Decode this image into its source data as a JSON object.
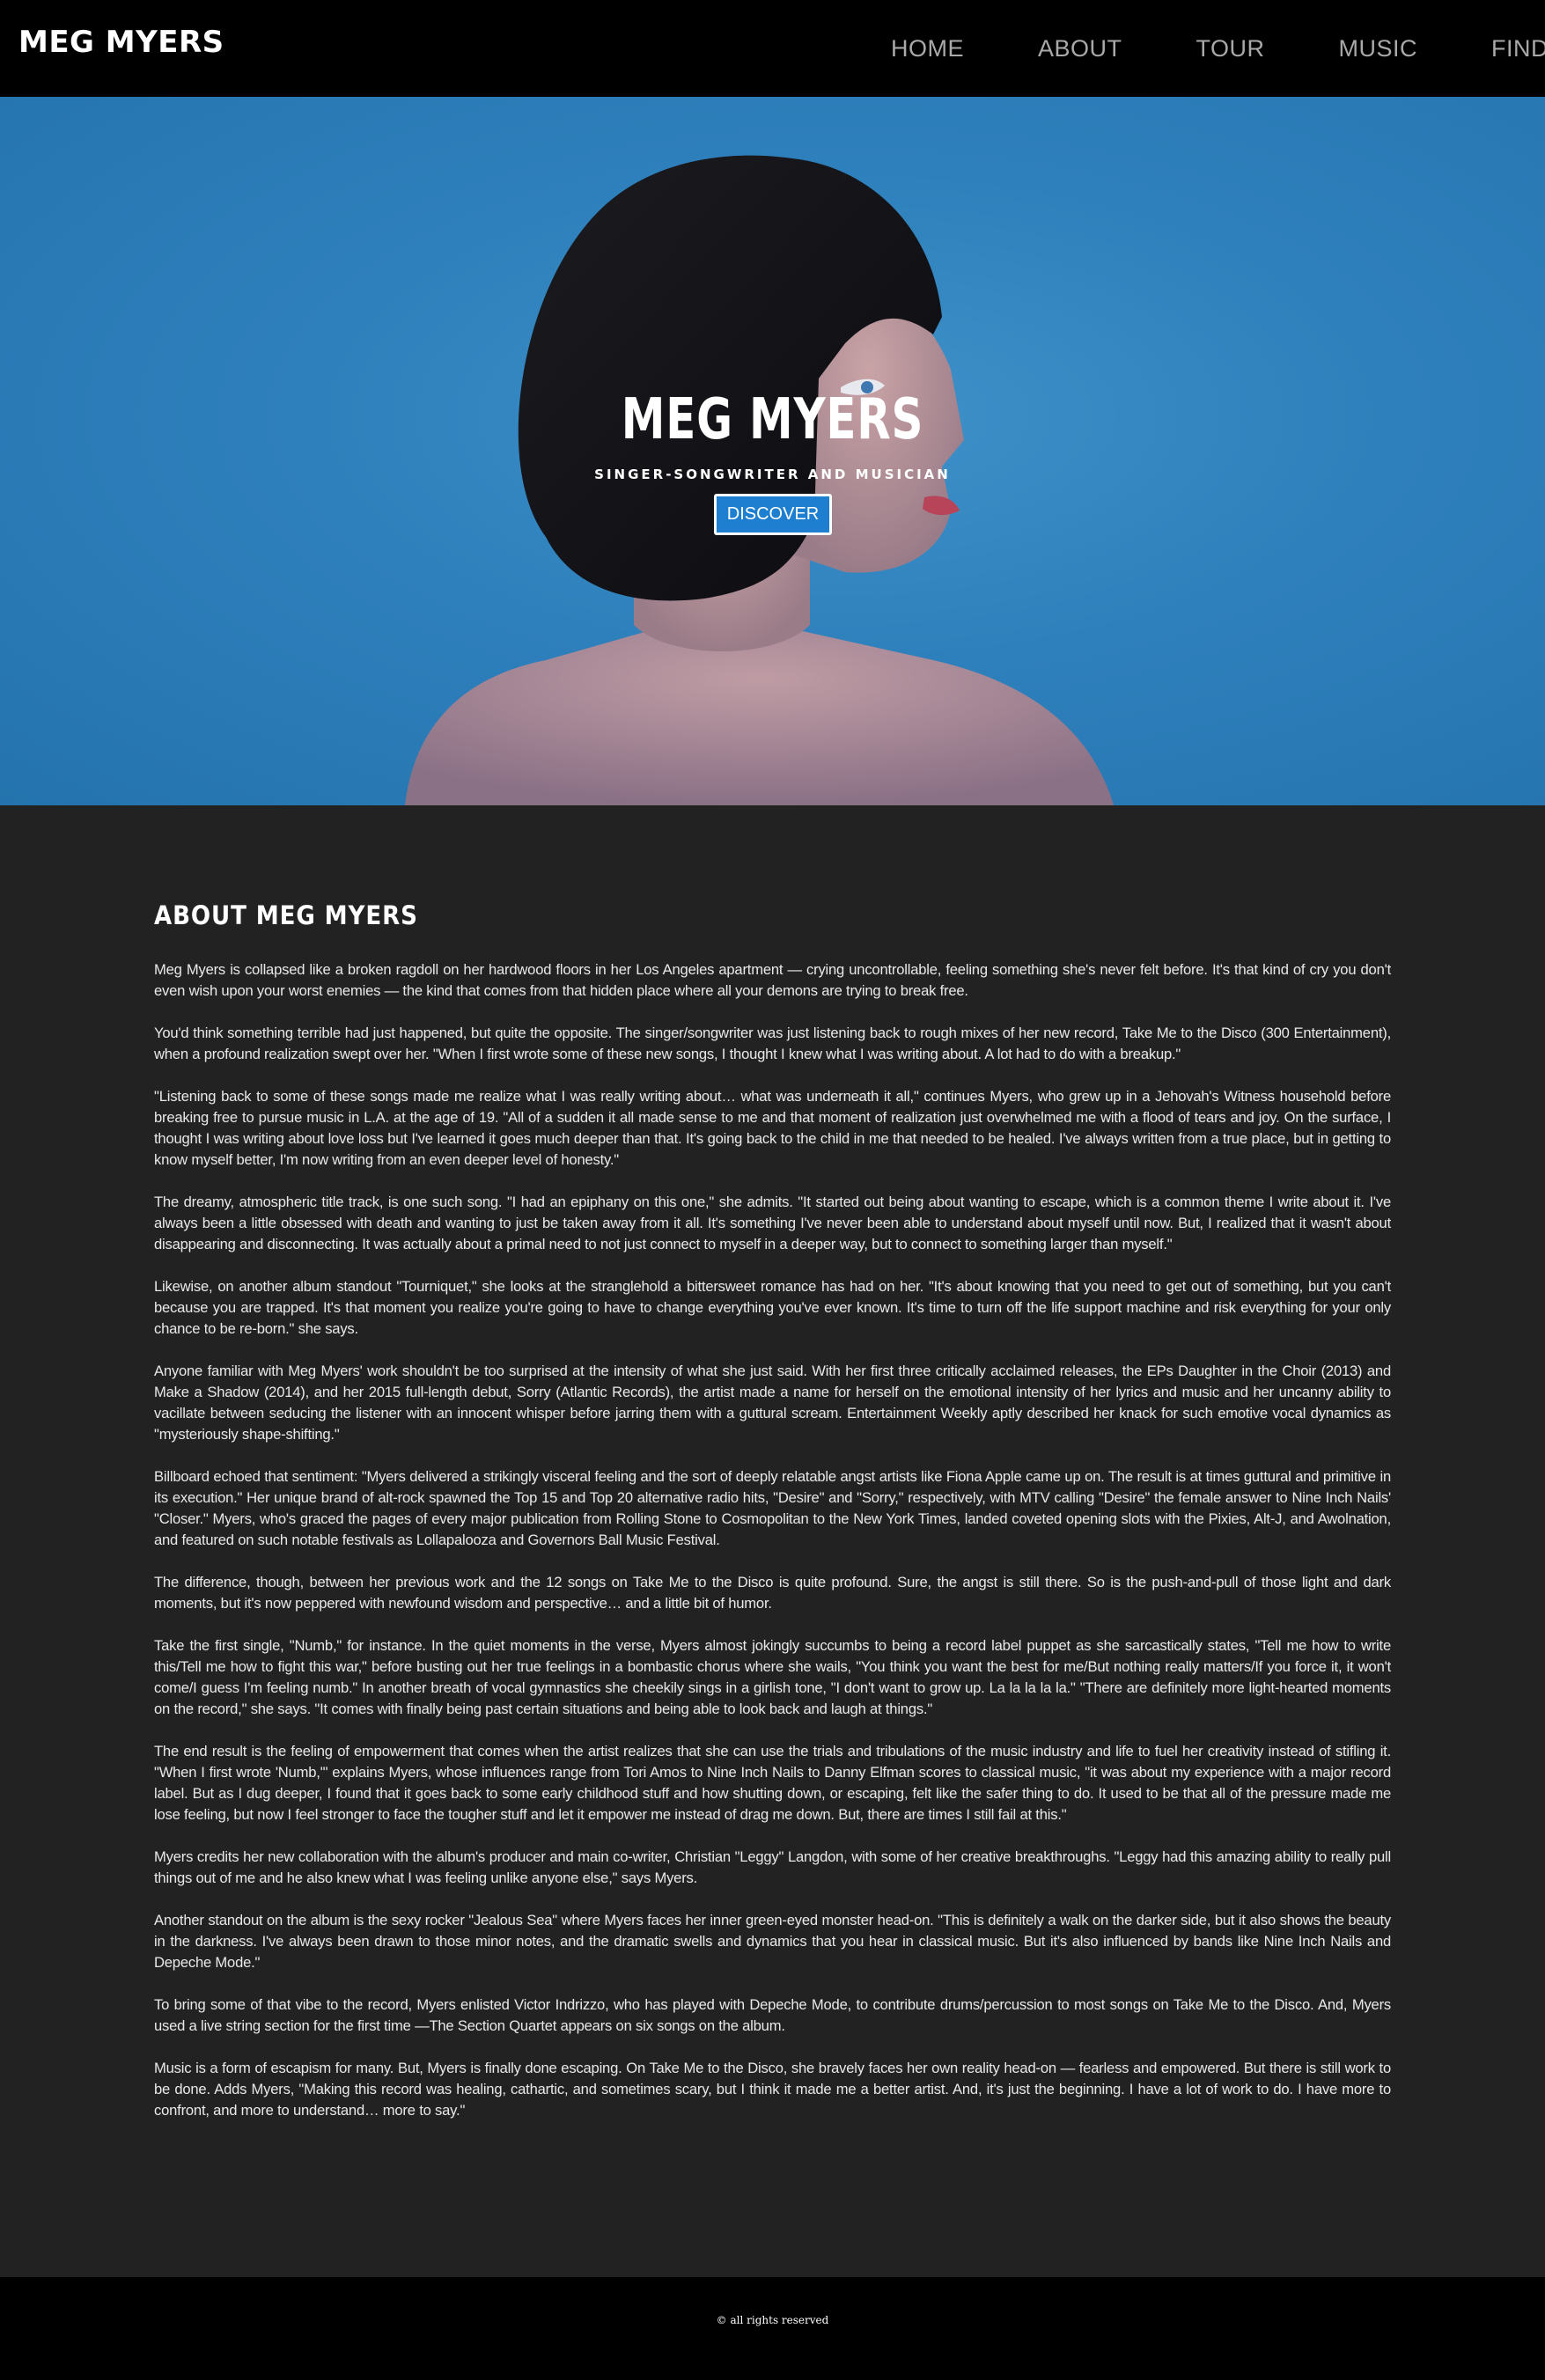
{
  "header": {
    "brand": "MEG MYERS",
    "nav": [
      "HOME",
      "ABOUT",
      "TOUR",
      "MUSIC",
      "FIND"
    ]
  },
  "hero": {
    "title": "MEG MYERS",
    "subtitle": "SINGER-SONGWRITER AND MUSICIAN",
    "button_label": "DISCOVER"
  },
  "about": {
    "heading": "ABOUT MEG MYERS",
    "paragraphs": [
      "Meg Myers is collapsed like a broken ragdoll on her hardwood floors in her Los Angeles apartment — crying uncontrollable, feeling something she's never felt before. It's that kind of cry you don't even wish upon your worst enemies — the kind that comes from that hidden place where all your demons are trying to break free.",
      "You'd think something terrible had just happened, but quite the opposite. The singer/songwriter was just listening back to rough mixes of her new record, Take Me to the Disco (300 Entertainment), when a profound realization swept over her. \"When I first wrote some of these new songs, I thought I knew what I was writing about. A lot had to do with a breakup.\"",
      "\"Listening back to some of these songs made me realize what I was really writing about… what was underneath it all,\" continues Myers, who grew up in a Jehovah's Witness household before breaking free to pursue music in L.A. at the age of 19. \"All of a sudden it all made sense to me and that moment of realization just overwhelmed me with a flood of tears and joy. On the surface, I thought I was writing about love loss but I've learned it goes much deeper than that. It's going back to the child in me that needed to be healed. I've always written from a true place, but in getting to know myself better, I'm now writing from an even deeper level of honesty.\"",
      "The dreamy, atmospheric title track, is one such song. \"I had an epiphany on this one,\" she admits. \"It started out being about wanting to escape, which is a common theme I write about it. I've always been a little obsessed with death and wanting to just be taken away from it all. It's something I've never been able to understand about myself until now. But, I realized that it wasn't about disappearing and disconnecting. It was actually about a primal need to not just connect to myself in a deeper way, but to connect to something larger than myself.\"",
      "Likewise, on another album standout \"Tourniquet,\" she looks at the stranglehold a bittersweet romance has had on her. \"It's about knowing that you need to get out of something, but you can't because you are trapped. It's that moment you realize you're going to have to change everything you've ever known. It's time to turn off the life support machine and risk everything for your only chance to be re-born.\" she says.",
      "Anyone familiar with Meg Myers' work shouldn't be too surprised at the intensity of what she just said. With her first three critically acclaimed releases, the EPs Daughter in the Choir (2013) and Make a Shadow (2014), and her 2015 full-length debut, Sorry (Atlantic Records), the artist made a name for herself on the emotional intensity of her lyrics and music and her uncanny ability to vacillate between seducing the listener with an innocent whisper before jarring them with a guttural scream. Entertainment Weekly aptly described her knack for such emotive vocal dynamics as \"mysteriously shape-shifting.\"",
      "Billboard echoed that sentiment: \"Myers delivered a strikingly visceral feeling and the sort of deeply relatable angst artists like Fiona Apple came up on. The result is at times guttural and primitive in its execution.\" Her unique brand of alt-rock spawned the Top 15 and Top 20 alternative radio hits, \"Desire\" and \"Sorry,\" respectively, with MTV calling \"Desire\" the female answer to Nine Inch Nails' \"Closer.\" Myers, who's graced the pages of every major publication from Rolling Stone to Cosmopolitan to the New York Times, landed coveted opening slots with the Pixies, Alt-J, and Awolnation, and featured on such notable festivals as Lollapalooza and Governors Ball Music Festival.",
      "The difference, though, between her previous work and the 12 songs on Take Me to the Disco is quite profound. Sure, the angst is still there. So is the push-and-pull of those light and dark moments, but it's now peppered with newfound wisdom and perspective… and a little bit of humor.",
      "Take the first single, \"Numb,\" for instance. In the quiet moments in the verse, Myers almost jokingly succumbs to being a record label puppet as she sarcastically states, \"Tell me how to write this/Tell me how to fight this war,\" before busting out her true feelings in a bombastic chorus where she wails, \"You think you want the best for me/But nothing really matters/If you force it, it won't come/I guess I'm feeling numb.\" In another breath of vocal gymnastics she cheekily sings in a girlish tone, \"I don't want to grow up. La la la la la.\" \"There are definitely more light-hearted moments on the record,\" she says. \"It comes with finally being past certain situations and being able to look back and laugh at things.\"",
      "The end result is the feeling of empowerment that comes when the artist realizes that she can use the trials and tribulations of the music industry and life to fuel her creativity instead of stifling it. \"When I first wrote 'Numb,'\" explains Myers, whose influences range from Tori Amos to Nine Inch Nails to Danny Elfman scores to classical music, \"it was about my experience with a major record label. But as I dug deeper, I found that it goes back to some early childhood stuff and how shutting down, or escaping, felt like the safer thing to do. It used to be that all of the pressure made me lose feeling, but now I feel stronger to face the tougher stuff and let it empower me instead of drag me down. But, there are times I still fail at this.\"",
      "Myers credits her new collaboration with the album's producer and main co-writer, Christian \"Leggy\" Langdon, with some of her creative breakthroughs. \"Leggy had this amazing ability to really pull things out of me and he also knew what I was feeling unlike anyone else,\" says Myers.",
      "Another standout on the album is the sexy rocker \"Jealous Sea\" where Myers faces her inner green-eyed monster head-on. \"This is definitely a walk on the darker side, but it also shows the beauty in the darkness. I've always been drawn to those minor notes, and the dramatic swells and dynamics that you hear in classical music. But it's also influenced by bands like Nine Inch Nails and Depeche Mode.\"",
      "To bring some of that vibe to the record, Myers enlisted Victor Indrizzo, who has played with Depeche Mode, to contribute drums/percussion to most songs on Take Me to the Disco. And, Myers used a live string section for the first time —The Section Quartet appears on six songs on the album.",
      "Music is a form of escapism for many. But, Myers is finally done escaping. On Take Me to the Disco, she bravely faces her own reality head-on — fearless and empowered. But there is still work to be done. Adds Myers, \"Making this record was healing, cathartic, and sometimes scary, but I think it made me a better artist. And, it's just the beginning. I have a lot of work to do. I have more to confront, and more to understand… more to say.\""
    ]
  },
  "footer": {
    "copyright": "© all rights reserved"
  },
  "colors": {
    "nav_bg": "#000000",
    "hero_blue": "#2e80bc",
    "button_blue": "#1e7fd0",
    "content_bg": "#222222"
  }
}
